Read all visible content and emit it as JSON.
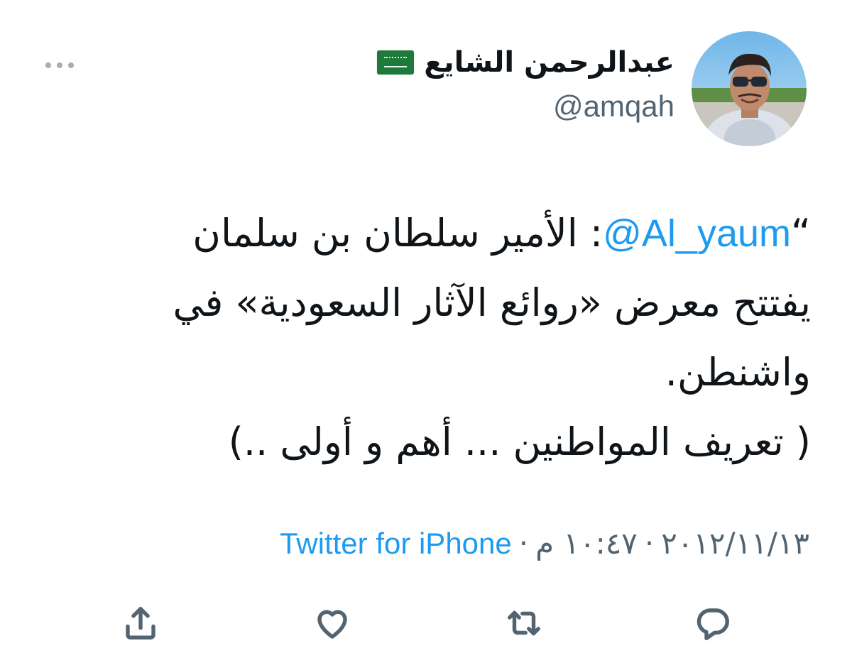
{
  "tweet": {
    "author": {
      "display_name": "عبدالرحمن الشايع",
      "handle": "@amqah",
      "flag_icon": "saudi-arabia-flag-icon"
    },
    "body": {
      "open_quote": "“",
      "mention": "@Al_yaum",
      "line1_text": ": الأمير سلطان بن سلمان",
      "line2": "يفتتح معرض «روائع الآثار السعودية» في",
      "line3": "واشنطن.",
      "line4": "( تعريف المواطنين ... أهم و أولى ..)"
    },
    "meta": {
      "date": "٢٠١٢/١١/١٣",
      "time": "١٠:٤٧ م",
      "separator": "·",
      "source": "Twitter for iPhone"
    },
    "actions": [
      {
        "name": "reply",
        "icon": "reply-icon"
      },
      {
        "name": "retweet",
        "icon": "retweet-icon"
      },
      {
        "name": "like",
        "icon": "heart-icon"
      },
      {
        "name": "share",
        "icon": "share-icon"
      }
    ],
    "more_icon": "more-options-icon"
  },
  "colors": {
    "accent": "#1d9bf0",
    "text": "#0f1419",
    "secondary": "#536471"
  }
}
